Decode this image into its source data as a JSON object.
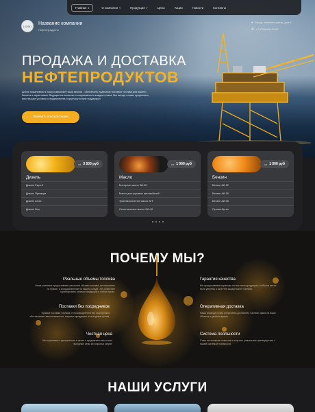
{
  "nav": {
    "items": [
      {
        "label": "Главная",
        "has_dropdown": true,
        "active": true
      },
      {
        "label": "О компании",
        "has_dropdown": true,
        "active": false
      },
      {
        "label": "Продукция",
        "has_dropdown": true,
        "active": false
      },
      {
        "label": "Цены",
        "has_dropdown": false,
        "active": false
      },
      {
        "label": "Акции",
        "has_dropdown": false,
        "active": false
      },
      {
        "label": "Новости",
        "has_dropdown": false,
        "active": false
      },
      {
        "label": "Контакты",
        "has_dropdown": false,
        "active": false
      }
    ]
  },
  "brand": {
    "logo_text": "LOGO",
    "name": "Название компании",
    "subtitle": "Нефтепродукты"
  },
  "contacts": {
    "address": "Город, название улицы, дом 1",
    "phone": "+7 (000) 000-00-00"
  },
  "hero": {
    "title_line1": "ПРОДАЖА И ДОСТАВКА",
    "title_line2": "НЕФТЕПРОДУКТОВ",
    "text": "Добро пожаловать в нашу компанию! Наша миссия - обеспечить надежные поставки топлива для вашего бизнеса с гарантиями. Ведущие на качество и оперативность каждого этапа. Мы всегда готовы предложить вам лучшие условия сотрудничества и круглосуточную поддержку!",
    "cta_label": "Заказать консультацию"
  },
  "products": [
    {
      "title": "Дизель",
      "price_prefix": "от",
      "price": "3 500 руб",
      "items": [
        "Дизель Евро-5",
        "Дизель Премиум",
        "Дизель Arctic",
        "Дизель Био"
      ]
    },
    {
      "title": "Масло",
      "price_prefix": "от",
      "price": "1 000 руб",
      "items": [
        "Моторное масло 5W-30",
        "Масло для грузовых автомобилей",
        "Трансмиссионное масло ATF",
        "Синтетическое масло 0W-40"
      ]
    },
    {
      "title": "Бензин",
      "price_prefix": "от",
      "price": "1 500 руб",
      "items": [
        "Бензин АИ-92",
        "Бензин АИ-95",
        "Бензин АИ-98",
        "Пропан-бутан"
      ]
    }
  ],
  "why": {
    "title": "ПОЧЕМУ МЫ?",
    "features": [
      {
        "title": "Реальные объемы топлива",
        "text": "Наша компания предоставляет реальные объемы топлива, не списанные на бумаге, а складированные на нашем складе. Это позволяет гарантировать наличие продукции в любое время."
      },
      {
        "title": "Поставки без посредников",
        "text": "Прямые поставки топлива от производителей без посредников обеспечивают вам возможность покупать продукцию по выгодным ценам."
      },
      {
        "title": "Честная цена",
        "text": "Мы стремимся к прозрачности в ценах и предлагаем вам только выгодные цены без скрытых затрат."
      },
      {
        "title": "Гарантия качества",
        "text": "Мы предоставляем гарантию на всю свою продукцию, чтобы вы могли быть уверены в качестве каждой капли топлива."
      },
      {
        "title": "Оперативная доставка",
        "text": "Наша команда готова оперативно доставлять топливо прямо на ваши объекты в удобное время."
      },
      {
        "title": "Система лояльности",
        "text": "Стать постоянным клиентом и получить уникальные преимущества с нашей системой лояльности."
      }
    ]
  },
  "services": {
    "title": "НАШИ УСЛУГИ"
  },
  "colors": {
    "accent": "#f5ae22",
    "panel": "#202022",
    "card": "#38393c"
  }
}
